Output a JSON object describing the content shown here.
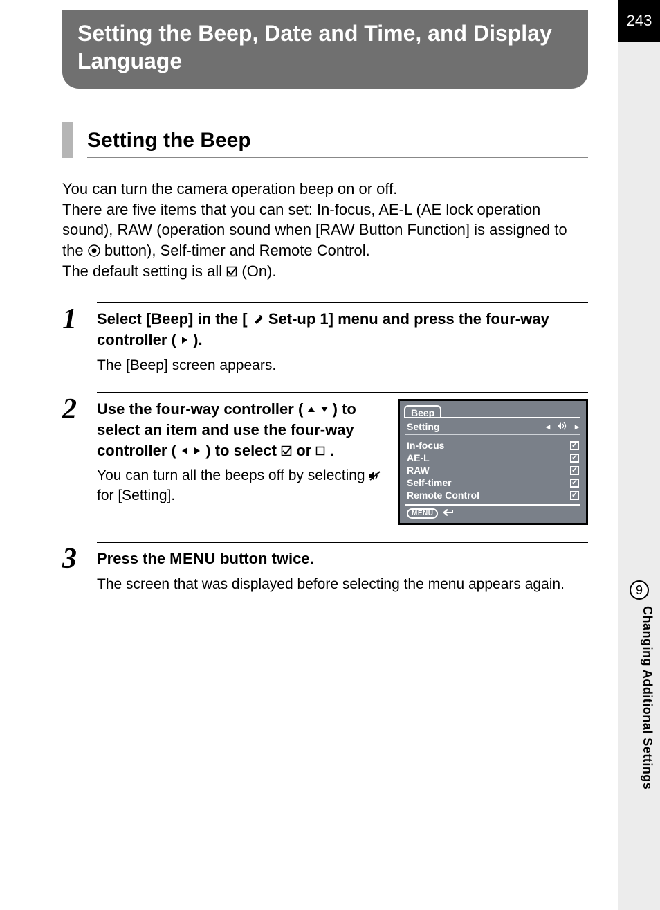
{
  "page_number": "243",
  "chapter_number": "9",
  "side_label": "Changing Additional Settings",
  "title": "Setting the Beep, Date and Time, and Display Language",
  "section_heading": "Setting the Beep",
  "intro_line1": "You can turn the camera operation beep on or off.",
  "intro_line2": "There are five items that you can set: In-focus, AE-L (AE lock operation sound), RAW (operation sound when [RAW Button Function] is assigned to the ",
  "intro_line2b": " button), Self-timer and Remote Control.",
  "intro_line3a": "The default setting is all ",
  "intro_line3b": " (On).",
  "steps": {
    "s1": {
      "num": "1",
      "title_a": "Select [Beep] in the [",
      "title_b": " Set-up 1] menu and press the four-way controller (",
      "title_c": ").",
      "desc": "The [Beep] screen appears."
    },
    "s2": {
      "num": "2",
      "title_a": "Use the four-way controller (",
      "title_b": ") to select an item and use the four-way controller (",
      "title_c": ") to select ",
      "title_d": " or ",
      "title_e": ".",
      "desc_a": "You can turn all the beeps off by selecting ",
      "desc_b": " for [Setting]."
    },
    "s3": {
      "num": "3",
      "title_a": "Press the ",
      "title_menu": "MENU",
      "title_b": " button twice.",
      "desc": "The screen that was displayed before selecting the menu appears again."
    }
  },
  "screen": {
    "tab": "Beep",
    "setting_label": "Setting",
    "items": {
      "r0": "In-focus",
      "r1": "AE-L",
      "r2": "RAW",
      "r3": "Self-timer",
      "r4": "Remote Control"
    },
    "menu_label": "MENU"
  }
}
